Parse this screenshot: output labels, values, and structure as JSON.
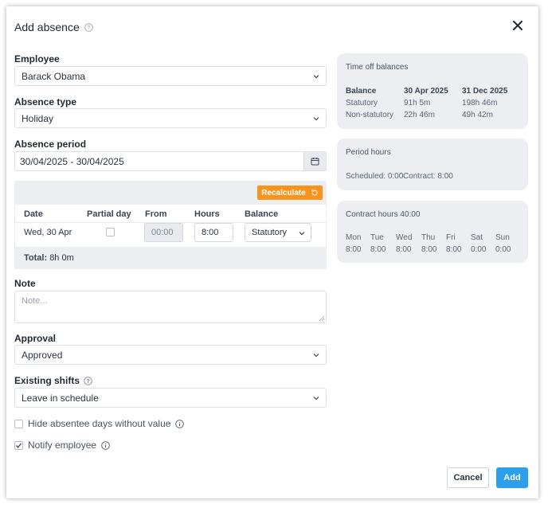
{
  "dialog": {
    "title": "Add absence",
    "employee": {
      "label": "Employee",
      "value": "Barack Obama"
    },
    "absence_type": {
      "label": "Absence type",
      "value": "Holiday"
    },
    "absence_period": {
      "label": "Absence period",
      "value": "30/04/2025 - 30/04/2025"
    },
    "period_table": {
      "recalculate_label": "Recalculate",
      "headers": [
        "Date",
        "Partial day",
        "From",
        "Hours",
        "Balance"
      ],
      "row": {
        "date": "Wed, 30 Apr",
        "partial_day": false,
        "from": "00:00",
        "hours": "8:00",
        "balance": "Statutory"
      },
      "total_label": "Total:",
      "total_value": "8h 0m"
    },
    "note": {
      "label": "Note",
      "placeholder": "Note..."
    },
    "approval": {
      "label": "Approval",
      "value": "Approved"
    },
    "existing_shifts": {
      "label": "Existing shifts",
      "value": "Leave in schedule"
    },
    "hide_absentee": {
      "label": "Hide absentee days without value",
      "checked": false
    },
    "notify_employee": {
      "label": "Notify employee",
      "checked": true
    },
    "cancel_label": "Cancel",
    "add_label": "Add"
  },
  "time_off_balances": {
    "title": "Time off balances",
    "headers": [
      "Balance",
      "30 Apr 2025",
      "31 Dec 2025"
    ],
    "rows": [
      [
        "Statutory",
        "91h 5m",
        "198h 46m"
      ],
      [
        "Non-statutory",
        "22h 46m",
        "49h 42m"
      ]
    ]
  },
  "period_hours": {
    "title": "Period hours",
    "scheduled": "Scheduled: 0:00",
    "contract": "Contract: 8:00"
  },
  "contract_hours": {
    "title": "Contract hours 40:00",
    "days": [
      "Mon",
      "Tue",
      "Wed",
      "Thu",
      "Fri",
      "Sat",
      "Sun"
    ],
    "values": [
      "8:00",
      "8:00",
      "8:00",
      "8:00",
      "8:00",
      "0:00",
      "0:00"
    ]
  },
  "colors": {
    "accent_orange": "#f7941d",
    "primary_blue": "#2ba0ee",
    "panel_bg": "#eceef2"
  }
}
